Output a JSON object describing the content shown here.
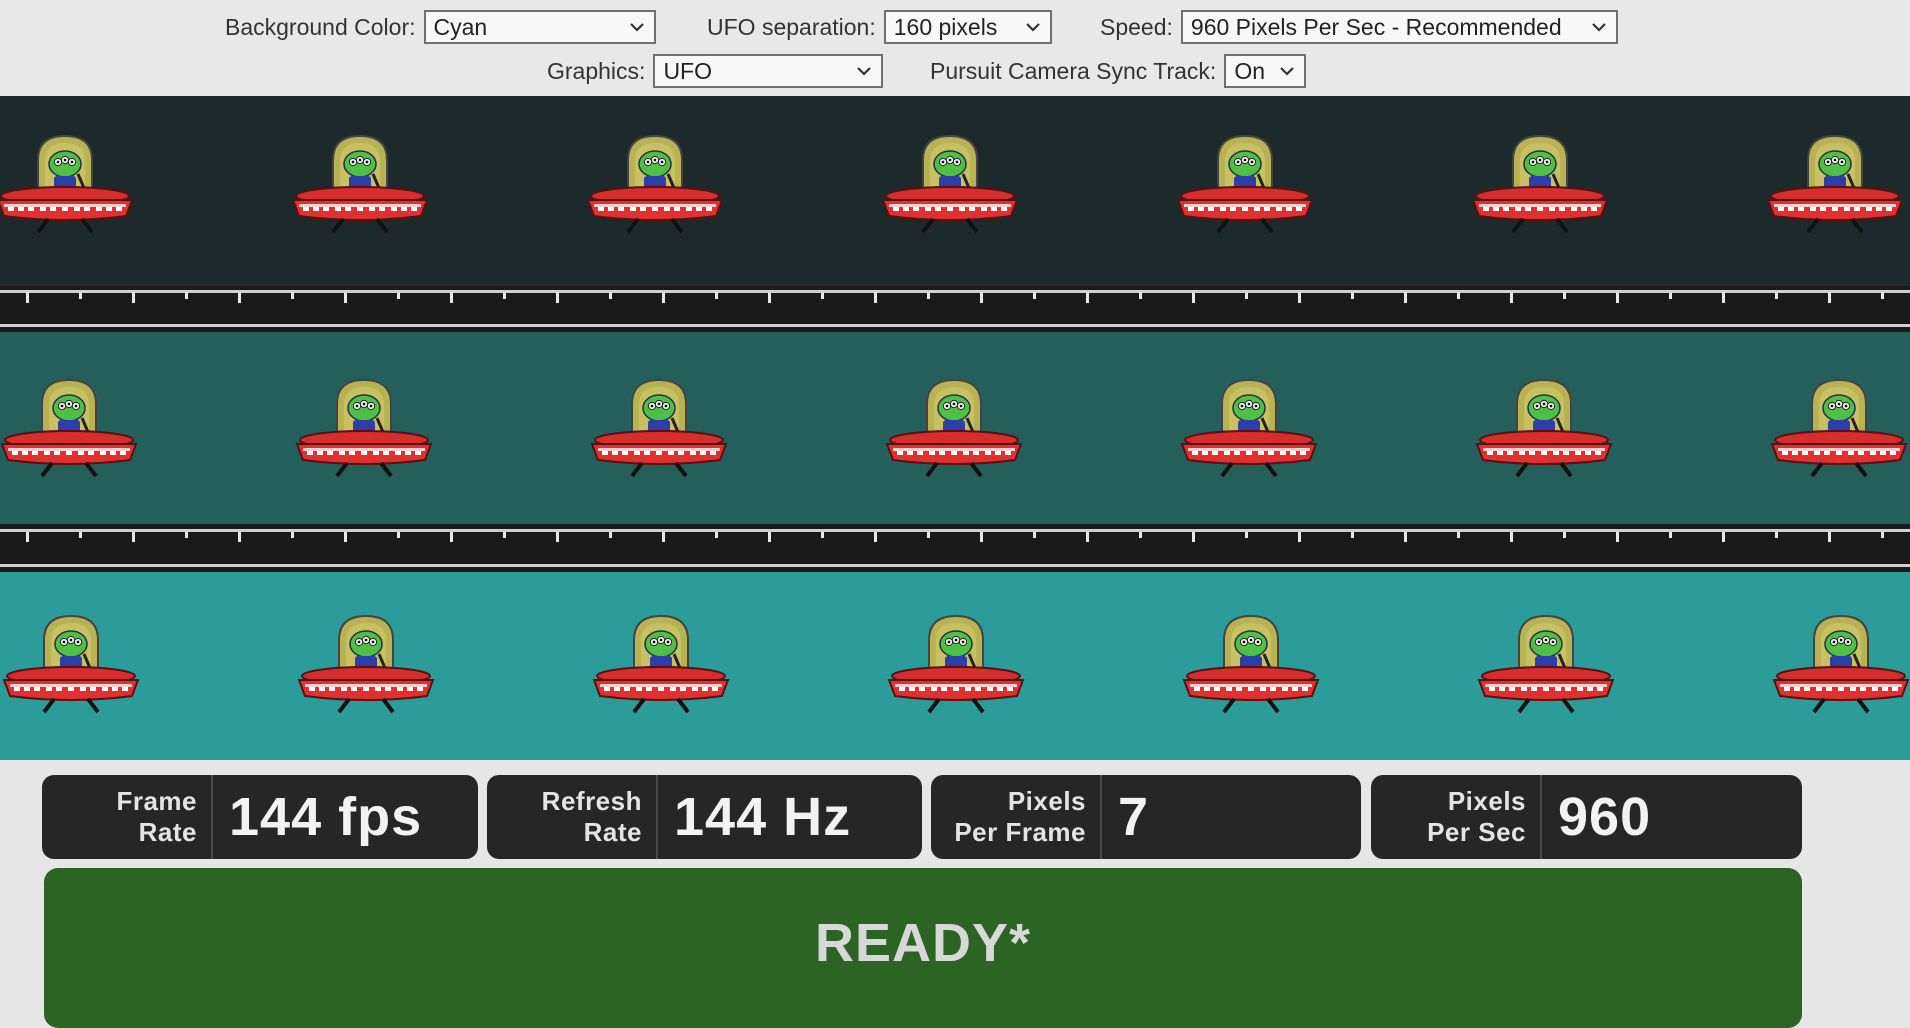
{
  "controls": {
    "background_color": {
      "label": "Background Color:",
      "value": "Cyan"
    },
    "ufo_separation": {
      "label": "UFO separation:",
      "value": "160 pixels"
    },
    "speed": {
      "label": "Speed:",
      "value": "960 Pixels Per Sec - Recommended"
    },
    "graphics": {
      "label": "Graphics:",
      "value": "UFO"
    },
    "pursuit_camera": {
      "label": "Pursuit Camera Sync Track:",
      "value": "On"
    }
  },
  "tracks": [
    {
      "name": "dark",
      "color": "#1c2a2c"
    },
    {
      "name": "medium",
      "color": "#245f5c"
    },
    {
      "name": "light",
      "color": "#2b9c99"
    }
  ],
  "ufos_per_track": 7,
  "stats": [
    {
      "label_line1": "Frame",
      "label_line2": "Rate",
      "value": "144 fps"
    },
    {
      "label_line1": "Refresh",
      "label_line2": "Rate",
      "value": "144 Hz"
    },
    {
      "label_line1": "Pixels",
      "label_line2": "Per Frame",
      "value": "7"
    },
    {
      "label_line1": "Pixels",
      "label_line2": "Per Sec",
      "value": "960"
    }
  ],
  "status": {
    "text": "READY*",
    "color": "#2b6423"
  },
  "icons": {
    "dropdown": "chevron-down-icon",
    "sprite": "ufo-alien-icon"
  }
}
